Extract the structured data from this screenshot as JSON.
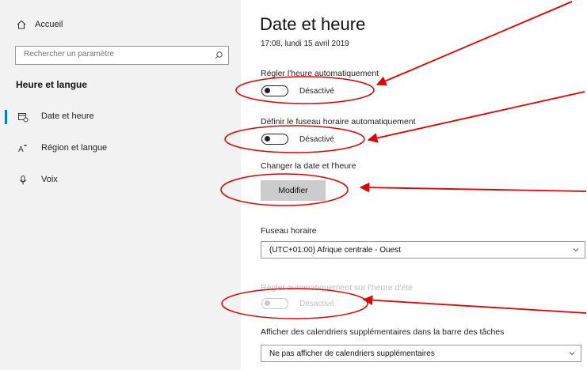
{
  "sidebar": {
    "home_label": "Accueil",
    "search_placeholder": "Rechercher un paramètre",
    "section_title": "Heure et langue",
    "items": [
      {
        "label": "Date et heure",
        "selected": true
      },
      {
        "label": "Région et langue",
        "selected": false
      },
      {
        "label": "Voix",
        "selected": false
      }
    ]
  },
  "main": {
    "title": "Date et heure",
    "datetime": "17:08, lundi 15 avril 2019",
    "auto_time": {
      "label": "Régler l'heure automatiquement",
      "state": "Désactivé"
    },
    "auto_timezone": {
      "label": "Définir le fuseau horaire automatiquement",
      "state": "Désactivé"
    },
    "change_datetime": {
      "label": "Changer la date et l'heure",
      "button": "Modifier"
    },
    "timezone": {
      "label": "Fuseau horaire",
      "value": "(UTC+01:00) Afrique centrale - Ouest"
    },
    "dst": {
      "label": "Régler automatiquement sur l'heure d'été",
      "state": "Désactivé"
    },
    "calendars": {
      "label": "Afficher des calendriers supplémentaires dans la barre des tâches",
      "value": "Ne pas afficher de calendriers supplémentaires"
    }
  },
  "colors": {
    "accent": "#0078d7",
    "annotation": "#e00000"
  }
}
